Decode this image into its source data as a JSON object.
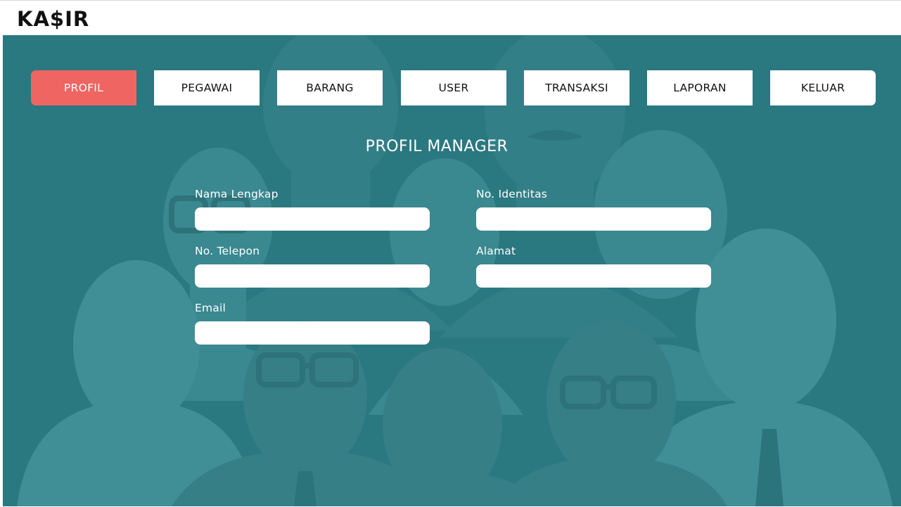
{
  "app": {
    "logo": "KA$IR"
  },
  "nav": {
    "items": [
      {
        "label": "PROFIL",
        "active": true
      },
      {
        "label": "PEGAWAI",
        "active": false
      },
      {
        "label": "BARANG",
        "active": false
      },
      {
        "label": "USER",
        "active": false
      },
      {
        "label": "TRANSAKSI",
        "active": false
      },
      {
        "label": "LAPORAN",
        "active": false
      },
      {
        "label": "KELUAR",
        "active": false
      }
    ]
  },
  "form": {
    "title": "PROFIL MANAGER",
    "fields": {
      "nama_lengkap": {
        "label": "Nama Lengkap",
        "value": ""
      },
      "no_identitas": {
        "label": "No. Identitas",
        "value": ""
      },
      "no_telepon": {
        "label": "No. Telepon",
        "value": ""
      },
      "alamat": {
        "label": "Alamat",
        "value": ""
      },
      "email": {
        "label": "Email",
        "value": ""
      }
    }
  },
  "colors": {
    "background_teal": "#2a7880",
    "active_tab": "#ef6562",
    "button_bg": "#ffffff",
    "text_dark": "#111111",
    "text_light": "#ffffff"
  },
  "icons": {
    "background": "people-crowd-illustration"
  }
}
